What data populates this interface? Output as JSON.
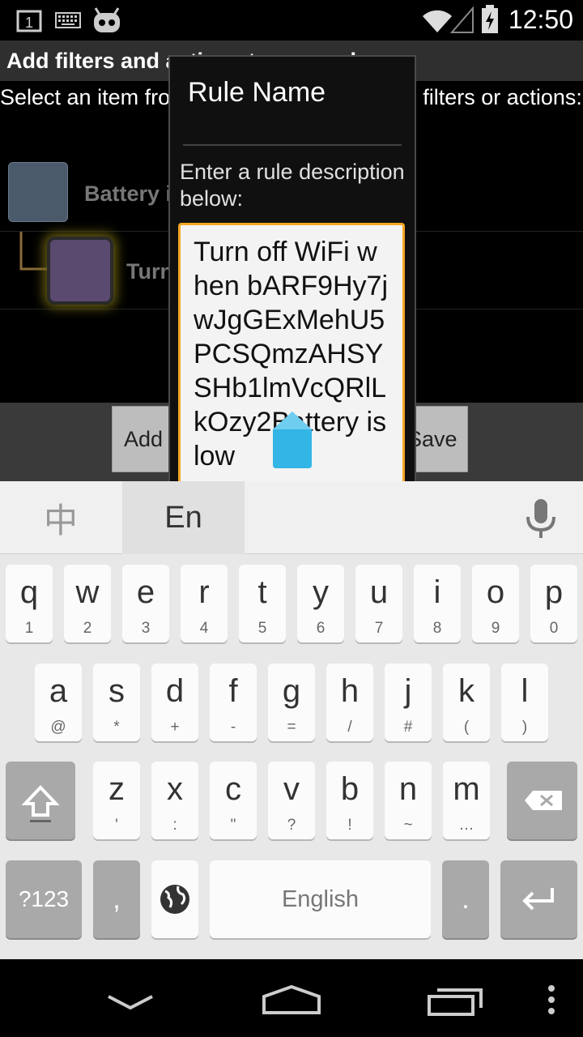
{
  "status_bar": {
    "time": "12:50",
    "icons": [
      "notification-1-icon",
      "keyboard-icon",
      "cyanogen-bot-icon",
      "wifi-icon",
      "signal-icon",
      "battery-charging-icon"
    ]
  },
  "background_screen": {
    "title": "Add filters and actions to your rule",
    "instructions": "Select an item from the list below, then add filters or actions:",
    "items": [
      {
        "label": "Battery is low",
        "color": "#4a5a6a"
      },
      {
        "label": "Turn off WiFi",
        "color": "#5a4a70"
      }
    ],
    "buttons": {
      "add_label": "Add filter",
      "save_label": "Save"
    }
  },
  "dialog": {
    "title": "Rule Name",
    "message": "Enter a rule description below:",
    "field_value": "Turn off WiFi when bARF9Hy7jwJgGExMehU5PCSQmzAHSYSHb1lmVcQRlLkOzy2Battery is low",
    "accent": "#f5a623"
  },
  "keyboard": {
    "lang_zh": "中",
    "lang_en": "En",
    "row1": [
      {
        "k": "q",
        "s": "1"
      },
      {
        "k": "w",
        "s": "2"
      },
      {
        "k": "e",
        "s": "3"
      },
      {
        "k": "r",
        "s": "4"
      },
      {
        "k": "t",
        "s": "5"
      },
      {
        "k": "y",
        "s": "6"
      },
      {
        "k": "u",
        "s": "7"
      },
      {
        "k": "i",
        "s": "8"
      },
      {
        "k": "o",
        "s": "9"
      },
      {
        "k": "p",
        "s": "0"
      }
    ],
    "row2": [
      {
        "k": "a",
        "s": "@"
      },
      {
        "k": "s",
        "s": "*"
      },
      {
        "k": "d",
        "s": "+"
      },
      {
        "k": "f",
        "s": "-"
      },
      {
        "k": "g",
        "s": "="
      },
      {
        "k": "h",
        "s": "/"
      },
      {
        "k": "j",
        "s": "#"
      },
      {
        "k": "k",
        "s": "("
      },
      {
        "k": "l",
        "s": ")"
      }
    ],
    "row3": [
      {
        "k": "z",
        "s": "'"
      },
      {
        "k": "x",
        "s": ":"
      },
      {
        "k": "c",
        "s": "\""
      },
      {
        "k": "v",
        "s": "?"
      },
      {
        "k": "b",
        "s": "!"
      },
      {
        "k": "n",
        "s": "~"
      },
      {
        "k": "m",
        "s": "…"
      }
    ],
    "symbols_label": "?123",
    "comma_label": ",",
    "space_label": "English",
    "period_label": "."
  }
}
